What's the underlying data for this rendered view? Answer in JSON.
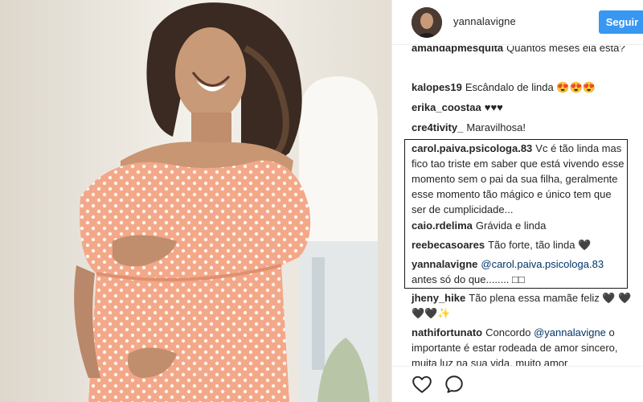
{
  "header": {
    "username": "yannalavigne",
    "follow_label": "Seguir"
  },
  "comments": [
    {
      "author": "amandapmesquita",
      "text": "Quantos meses ela está?"
    },
    {
      "author": "kalopes19",
      "text": "Escândalo de linda 😍😍😍"
    },
    {
      "author": "erika_coostaa",
      "text": "♥♥♥"
    },
    {
      "author": "cre4tivity_",
      "text": "Maravilhosa!"
    },
    {
      "author": "carol.paiva.psicologa.83",
      "text": "Vc é tão linda mas fico tao triste em saber que está vivendo esse momento sem o pai da sua filha, geralmente esse momento tão mágico e único tem que ser de cumplicidade..."
    },
    {
      "author": "caio.rdelima",
      "text": "Grávida e linda"
    },
    {
      "author": "reebecasoares",
      "text": "Tão forte, tão linda 🖤"
    },
    {
      "author": "yannalavigne",
      "mention": "@carol.paiva.psicologa.83",
      "text": "antes só do que........ □□"
    },
    {
      "author": "jheny_hike",
      "text": "Tão plena essa mamãe feliz 🖤 🖤🖤🖤✨"
    },
    {
      "author": "nathifortunato",
      "text_before": "Concordo",
      "mention": "@yannalavigne",
      "text": "o importante é estar rodeada de amor sincero, muita luz na sua vida, muito amor"
    }
  ],
  "icons": {
    "like": "heart-outline",
    "comment": "speech-bubble-outline"
  },
  "colors": {
    "follow_button": "#3897f0",
    "mention": "#003569",
    "text": "#262626",
    "dress": "#f2a889"
  }
}
